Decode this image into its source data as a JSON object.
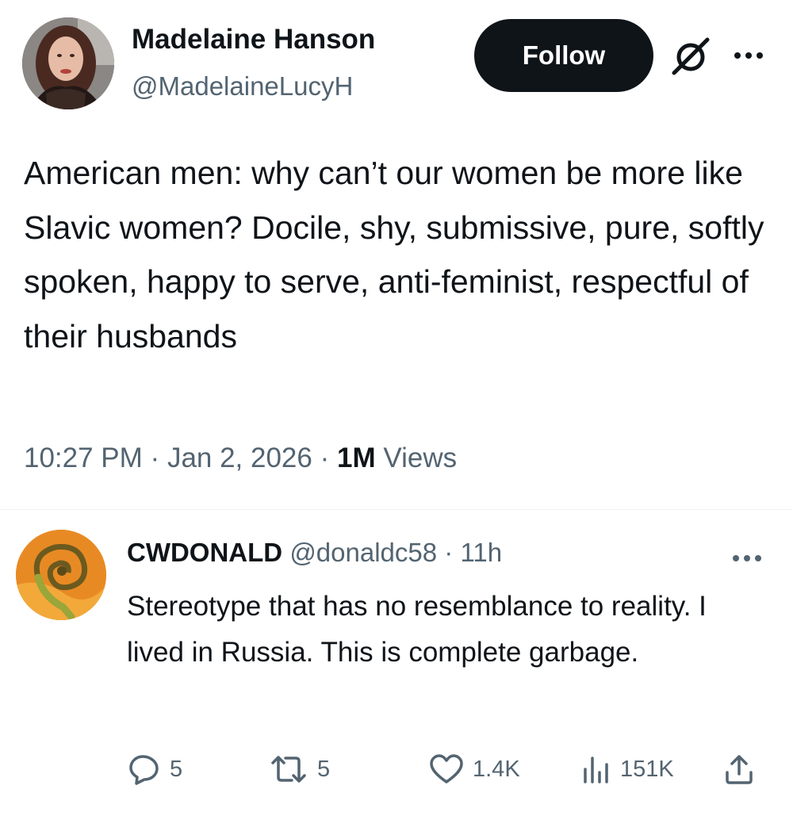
{
  "tweet": {
    "author_name": "Madelaine Hanson",
    "author_handle": "@MadelaineLucyH",
    "follow_label": "Follow",
    "text": "American men: why can’t our women be more like Slavic women? Docile, shy, submissive, pure, softly spoken, happy to serve, anti-feminist, respectful of their husbands",
    "time": "10:27 PM",
    "date": "Jan 2, 2026",
    "views_count": "1M",
    "views_label": "Views",
    "separator": "·"
  },
  "reply": {
    "author_name": "CWDONALD",
    "author_handle": "@donaldc58",
    "age": "11h",
    "text": "Stereotype that has no resemblance to reality. I lived in Russia. This is complete garbage.",
    "actions": {
      "replies": "5",
      "reposts": "5",
      "likes": "1.4K",
      "views": "151K"
    }
  },
  "icons": {
    "grok": "grok-icon",
    "more": "more-horizontal-icon",
    "reply": "reply-icon",
    "repost": "repost-icon",
    "like": "heart-icon",
    "views": "analytics-icon",
    "share": "share-icon"
  },
  "colors": {
    "text_primary": "#0f1419",
    "text_secondary": "#536471",
    "follow_bg": "#0f1419",
    "follow_text": "#ffffff"
  }
}
